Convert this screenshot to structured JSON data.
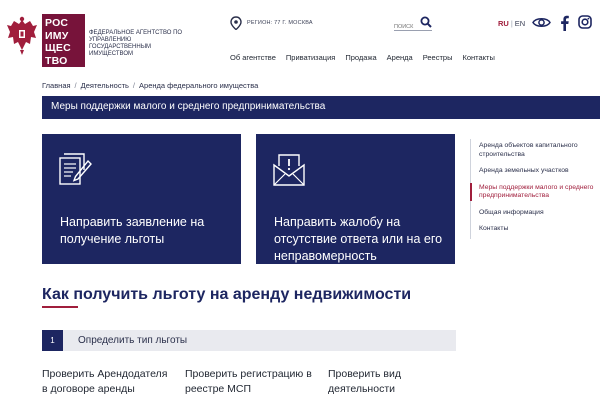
{
  "header": {
    "logo_lines": [
      "РОС",
      "ИМУ",
      "ЩЕС",
      "ТВО"
    ],
    "agency_name": "Федеральное агентство по управлению государственным имуществом",
    "region_label": "Регион: 77 г. Москва",
    "search_placeholder": "Поиск",
    "lang": {
      "active": "RU",
      "separator": "|",
      "inactive": "EN"
    },
    "icons": [
      "location-pin-icon",
      "search-icon",
      "eye-icon",
      "facebook-icon",
      "instagram-icon"
    ],
    "nav": [
      "Об агентстве",
      "Приватизация",
      "Продажа",
      "Аренда",
      "Реестры",
      "Контакты"
    ]
  },
  "breadcrumb": [
    "Главная",
    "Деятельность",
    "Аренда федерального имущества"
  ],
  "breadcrumb_sep": "/",
  "section_title": "Меры поддержки малого и среднего предпринимательства",
  "cards": [
    {
      "title": "Направить заявление на получение льготы",
      "icon": "document-pen-icon"
    },
    {
      "title": "Направить жалобу на отсутствие ответа или на его неправомерность",
      "icon": "envelope-alert-icon"
    }
  ],
  "side_menu": [
    {
      "label": "Аренда объектов капитального строительства",
      "active": false
    },
    {
      "label": "Аренда земельных участков",
      "active": false
    },
    {
      "label": "Меры поддержки малого и среднего предпринимательства",
      "active": true
    },
    {
      "label": "Общая информация",
      "active": false
    },
    {
      "label": "Контакты",
      "active": false
    }
  ],
  "main": {
    "title": "Как получить льготу на аренду недвижимости",
    "step": {
      "number": "1",
      "label": "Определить тип льготы"
    },
    "checks": [
      "Проверить Арендодателя в договоре аренды",
      "Проверить регистрацию в реестре МСП",
      "Проверить вид деятельности"
    ]
  },
  "colors": {
    "navy": "#1d2661",
    "brand": "#77133a",
    "accent": "#a01e3c",
    "step_bg": "#e9eaef"
  }
}
